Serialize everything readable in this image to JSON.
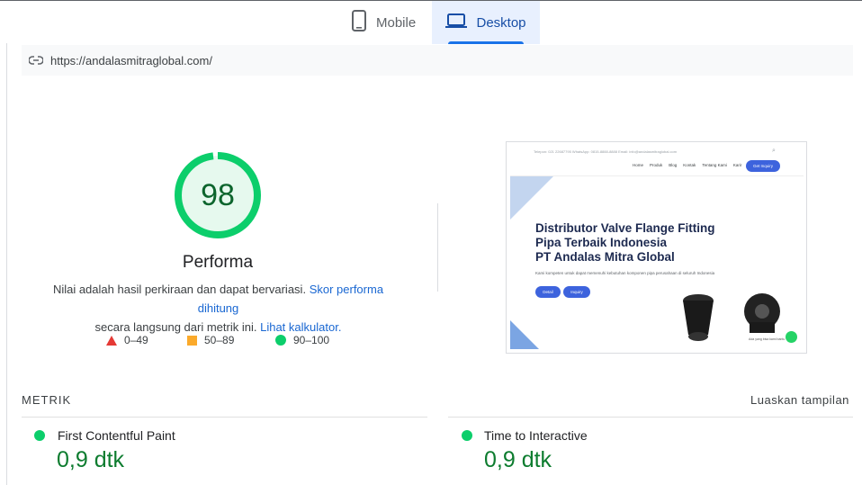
{
  "tabs": [
    {
      "label": "Mobile",
      "icon": "phone-icon",
      "active": false
    },
    {
      "label": "Desktop",
      "icon": "laptop-icon",
      "active": true
    }
  ],
  "url": "https://andalasmitraglobal.com/",
  "score": {
    "value": "98",
    "title": "Performa",
    "description_1": "Nilai adalah hasil perkiraan dan dapat bervariasi.",
    "link_1": "Skor performa dihitung",
    "description_2": "secara langsung dari metrik ini.",
    "link_2": "Lihat kalkulator.",
    "gauge_fraction": 0.98,
    "color": "#0cce6b"
  },
  "legend": [
    {
      "range": "0–49",
      "shape": "triangle",
      "color": "#e53935"
    },
    {
      "range": "50–89",
      "shape": "square",
      "color": "#fbaa2b"
    },
    {
      "range": "90–100",
      "shape": "circle",
      "color": "#0cce6b"
    }
  ],
  "thumbnail": {
    "topbar": "Telepon: 021 22687795 WhatsApp: 0815-8888-8888 Email: info@andalasmitraglobal.com",
    "nav": [
      "Home",
      "Produk",
      "Blog",
      "Kontak",
      "Tentang Kami",
      "Karir"
    ],
    "nav_button": "Get Inquiry",
    "title_1": "Distributor Valve Flange Fitting",
    "title_2": "Pipa Terbaik Indonesia",
    "title_3": "PT Andalas Mitra Global",
    "subtitle": "Kami kompeten untuk dapat memenuhi kebutuhan komponen pipa perusahaan di seluruh Indonesia",
    "button_1": "Detail",
    "button_2": "Inquiry",
    "caption": "Ada yang bisa kami bantu"
  },
  "metrics_section": {
    "title": "METRIK",
    "expand_label": "Luaskan tampilan",
    "items": [
      {
        "label": "First Contentful Paint",
        "value": "0,9 dtk",
        "status": "good"
      },
      {
        "label": "Time to Interactive",
        "value": "0,9 dtk",
        "status": "good"
      }
    ]
  }
}
